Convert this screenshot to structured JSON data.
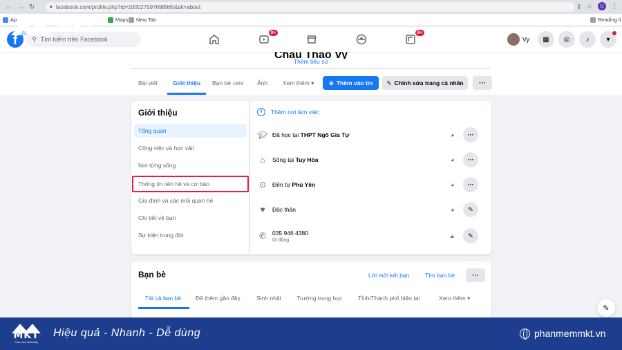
{
  "browser": {
    "url": "facebook.com/profile.php?id=100027597698965&sk=about",
    "profile_initial": "U",
    "bookmarks": [
      "Ap",
      "Maps",
      "New Tab",
      "Reading li"
    ]
  },
  "logo": {
    "text": "MKT",
    "sub": "Phần mềm Marketing đa kênh"
  },
  "header": {
    "search_placeholder": "Tìm kiếm trên Facebook",
    "watch_badge": "9+",
    "gaming_badge": "9+",
    "profile_name": "Vy"
  },
  "profile": {
    "name": "Châu Thảo Vy",
    "add_bio": "Thêm tiểu sử",
    "tabs": [
      {
        "label": "Bài viết"
      },
      {
        "label": "Giới thiệu"
      },
      {
        "label": "Bạn bè",
        "count": "1849"
      },
      {
        "label": "Ảnh"
      },
      {
        "label": "Xem thêm"
      }
    ],
    "add_story": "Thêm vào tin",
    "edit_profile": "Chỉnh sửa trang cá nhân"
  },
  "intro": {
    "title": "Giới thiệu",
    "sidebar": [
      "Tổng quan",
      "Công việc và học vấn",
      "Nơi từng sống",
      "Thông tin liên hệ và cơ bản",
      "Gia đình và các mối quan hệ",
      "Chi tiết về bạn",
      "Sự kiện trong đời"
    ],
    "add_work": "Thêm nơi làm việc",
    "rows": [
      {
        "prefix": "Đã học tại ",
        "bold": "THPT Ngô Gia Tự"
      },
      {
        "prefix": "Sống tại ",
        "bold": "Tuy Hòa"
      },
      {
        "prefix": "Đến từ ",
        "bold": "Phú Yên"
      },
      {
        "prefix": "Độc thân",
        "bold": ""
      },
      {
        "prefix": "035 946 4380",
        "bold": "",
        "sub": "Di động"
      }
    ]
  },
  "friends": {
    "title": "Bạn bè",
    "requests": "Lời mời kết bạn",
    "find": "Tìm bạn bè",
    "tabs": [
      "Tất cả bạn bè",
      "Đã thêm gần đây",
      "Sinh nhật",
      "Trường trung học",
      "Tỉnh/Thành phố hiện tại",
      "Xem thêm"
    ]
  },
  "banner": {
    "logo": "MKT",
    "logo_sub": "Phần mềm Marketing",
    "slogan": "Hiệu quả - Nhanh  - Dễ dùng",
    "site": "phanmemmkt.vn"
  },
  "colors": {
    "fb_blue": "#1877f2",
    "banner_blue": "#1d3d8f",
    "highlight_red": "#e41e3f"
  }
}
